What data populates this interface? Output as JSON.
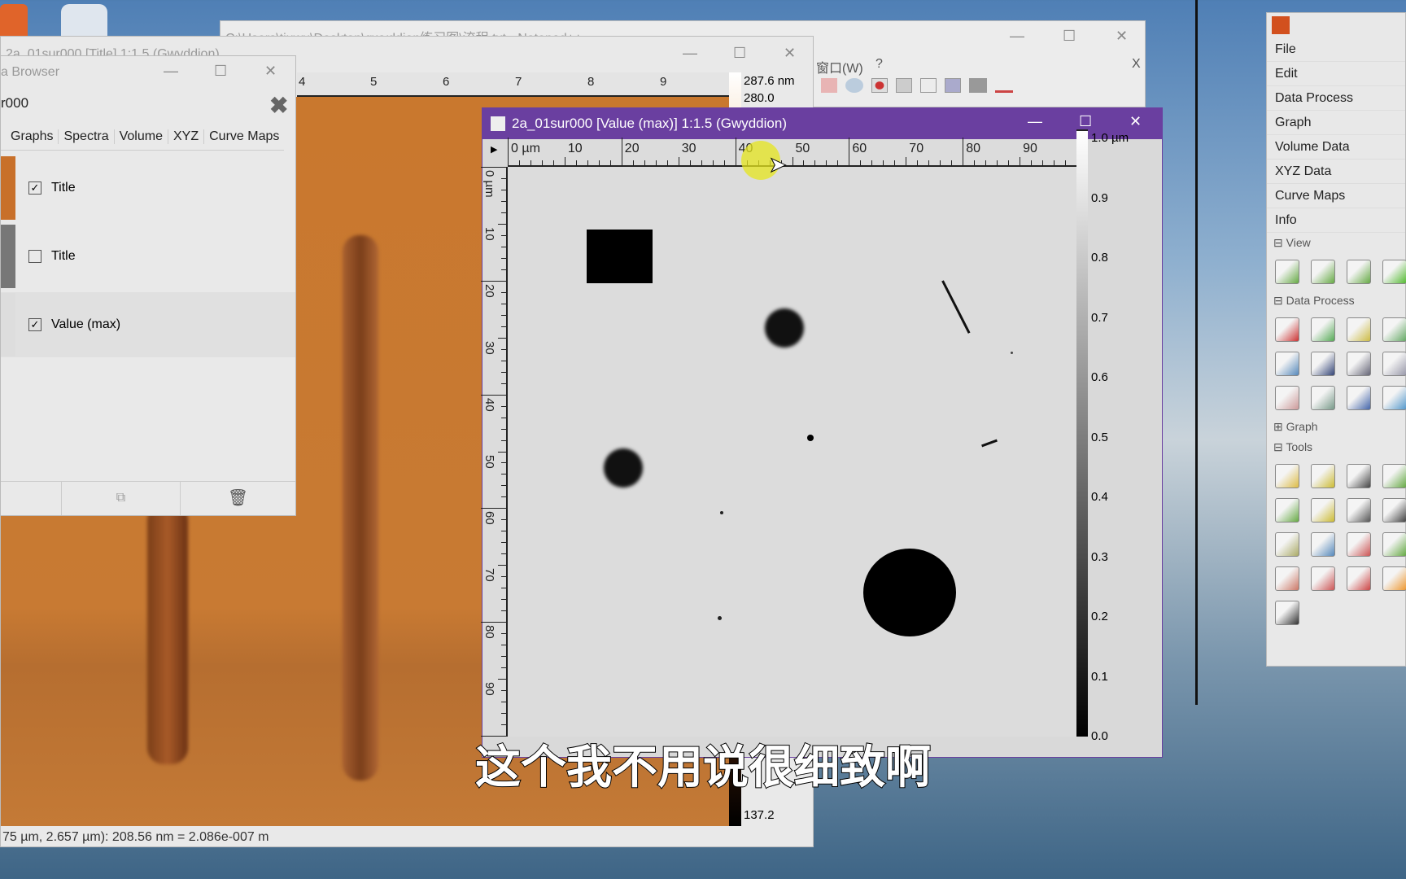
{
  "notepad": {
    "title": "C:\\Users\\tiuwu\\Desktop\\gwyddion练习图\\流程.txt - Notepad++",
    "menu_window": "窗口(W)",
    "menu_help": "?",
    "close_tab": "X"
  },
  "title_window": {
    "title": "2a_01sur000 [Title] 1:1.5 (Gwyddion)",
    "ruler_labels": [
      "4",
      "5",
      "6",
      "7",
      "8",
      "9"
    ],
    "colorbar_max": "287.6 nm",
    "colorbar_second": "280.0",
    "colorbar_min": "137.2",
    "status": "75 µm, 2.657 µm): 208.56 nm = 2.086e-007 m"
  },
  "browser": {
    "title": "a Browser",
    "file": "r000",
    "tabs": [
      "Graphs",
      "Spectra",
      "Volume",
      "XYZ",
      "Curve Maps"
    ],
    "items": [
      {
        "label": "Title",
        "checked": true
      },
      {
        "label": "Title",
        "checked": false
      },
      {
        "label": "Value (max)",
        "checked": true
      }
    ]
  },
  "main_window": {
    "title": "2a_01sur000 [Value (max)] 1:1.5 (Gwyddion)",
    "accent": "#6a3fa0",
    "x_ticks": [
      "0 µm",
      "10",
      "20",
      "30",
      "40",
      "50",
      "60",
      "70",
      "80",
      "90"
    ],
    "y_ticks": [
      "0 µm",
      "10",
      "20",
      "30",
      "40",
      "50",
      "60",
      "70",
      "80",
      "90"
    ],
    "colorbar_labels": [
      "1.0 µm",
      "0.9",
      "0.8",
      "0.7",
      "0.6",
      "0.5",
      "0.4",
      "0.3",
      "0.2",
      "0.1",
      "0.0"
    ]
  },
  "toolbox": {
    "menu": [
      "File",
      "Edit",
      "Data Process",
      "Graph",
      "Volume Data",
      "XYZ Data",
      "Curve Maps",
      "Info"
    ],
    "sections": {
      "view": "View",
      "data_process": "Data Process",
      "graph": "Graph",
      "tools": "Tools"
    },
    "view_icons": [
      "zoom-in-icon",
      "zoom-1-1-icon",
      "zoom-out-icon",
      "3d-view-icon"
    ],
    "process_icons": [
      "level-icon",
      "crop-icon",
      "scale-icon",
      "arithmetic-icon",
      "fft-icon",
      "line-correct-icon",
      "align-rows-icon",
      "grains-icon",
      "mark-icon",
      "statistics-icon",
      "sphere-icon",
      "gradient-icon"
    ],
    "tool_icons": [
      "pointer-tool-icon",
      "distance-tool-icon",
      "crosshair-tool-icon",
      "profile-tool-icon",
      "fit-tool-icon",
      "stats-tool-icon",
      "curve-tool-icon",
      "spectro-tool-icon",
      "level-tool-icon",
      "mask-tool-icon",
      "filter-tool-icon",
      "crop-tool-icon",
      "grain-tool-icon",
      "remove-spots-icon",
      "remove-icon",
      "colorrange-icon",
      "path-tool-icon"
    ]
  },
  "subtitle": "这个我不用说很细致啊"
}
